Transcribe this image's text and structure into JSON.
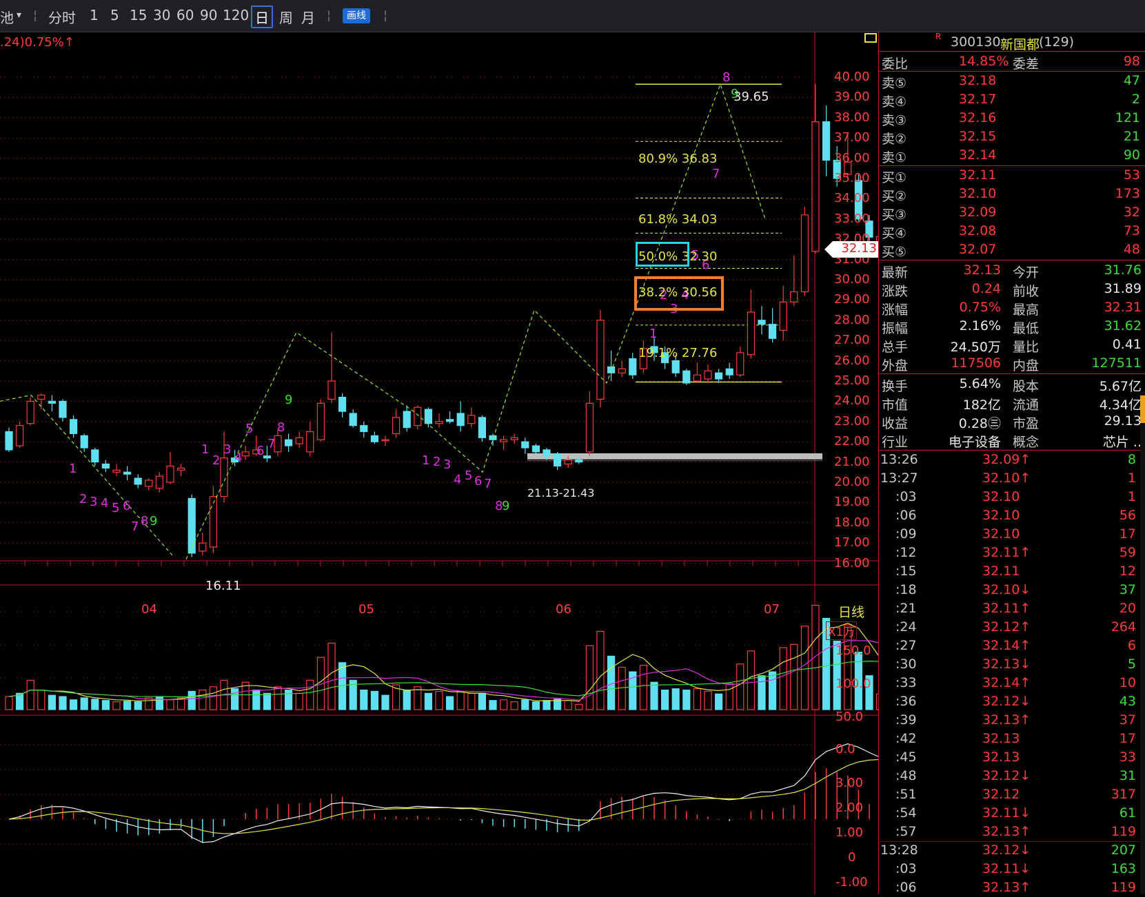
{
  "toolbar": {
    "stock_short": "池",
    "dropdown": "▾",
    "periods": [
      "分时",
      "1",
      "5",
      "15",
      "30",
      "60",
      "90",
      "120",
      "日",
      "周",
      "月"
    ],
    "active_period": "日",
    "draw_button": "画线"
  },
  "chart_header": {
    "change_text": ".24)0.75%↑"
  },
  "price_axis": [
    "40.00",
    "39.00",
    "38.00",
    "37.00",
    "36.00",
    "35.00",
    "34.00",
    "33.00",
    "32.00",
    "31.00",
    "30.00",
    "29.00",
    "28.00",
    "27.00",
    "26.00",
    "25.00",
    "24.00",
    "23.00",
    "22.00",
    "21.00",
    "20.00",
    "19.00",
    "18.00",
    "17.00",
    "16.00"
  ],
  "current_price_tag": "32.13",
  "annotations": {
    "high_label": "39.65",
    "low_label": "16.11",
    "gap_label": "21.13-21.43",
    "fib": [
      {
        "label": "80.9% 36.83",
        "price": 36.83
      },
      {
        "label": "61.8% 34.03",
        "price": 34.03
      },
      {
        "label": "50.0% 32.30",
        "price": 32.3
      },
      {
        "label": "38.2% 30.56",
        "price": 30.56
      },
      {
        "label": "19.1% 27.76",
        "price": 27.76
      }
    ],
    "fib_high": 39.65,
    "fib_low": 24.95,
    "fib_box_colors": {
      "50": "#29d3e3",
      "38": "#f08030"
    }
  },
  "month_labels": [
    "04",
    "05",
    "06",
    "07"
  ],
  "period_tag": "日线",
  "volume_panel": {
    "unit": "X1万",
    "axis": [
      "150.0",
      "100.0",
      "50.0",
      "0.0"
    ]
  },
  "macd_panel": {
    "axis": [
      "3.00",
      "2.00",
      "1.00",
      "0",
      "-1.00"
    ]
  },
  "quote": {
    "flag": "R",
    "code": "300130",
    "name": "新国都",
    "count": "(129)",
    "weibi_label": "委比",
    "weibi": "14.85%",
    "weicha_label": "委差",
    "weicha": "98",
    "sell": [
      {
        "label": "卖⑤",
        "price": "32.18",
        "vol": "47"
      },
      {
        "label": "卖④",
        "price": "32.17",
        "vol": "2"
      },
      {
        "label": "卖③",
        "price": "32.16",
        "vol": "121"
      },
      {
        "label": "卖②",
        "price": "32.15",
        "vol": "21"
      },
      {
        "label": "卖①",
        "price": "32.14",
        "vol": "90"
      }
    ],
    "buy": [
      {
        "label": "买①",
        "price": "32.11",
        "vol": "53"
      },
      {
        "label": "买②",
        "price": "32.10",
        "vol": "173"
      },
      {
        "label": "买③",
        "price": "32.09",
        "vol": "32"
      },
      {
        "label": "买④",
        "price": "32.08",
        "vol": "73"
      },
      {
        "label": "买⑤",
        "price": "32.07",
        "vol": "48"
      }
    ],
    "stats": [
      {
        "l1": "最新",
        "v1": "32.13",
        "c1": "red",
        "l2": "今开",
        "v2": "31.76",
        "c2": "green"
      },
      {
        "l1": "涨跌",
        "v1": "0.24",
        "c1": "red",
        "l2": "前收",
        "v2": "31.89",
        "c2": "white"
      },
      {
        "l1": "涨幅",
        "v1": "0.75%",
        "c1": "red",
        "l2": "最高",
        "v2": "32.31",
        "c2": "red"
      },
      {
        "l1": "振幅",
        "v1": "2.16%",
        "c1": "white",
        "l2": "最低",
        "v2": "31.62",
        "c2": "green"
      },
      {
        "l1": "总手",
        "v1": "24.50万",
        "c1": "white",
        "l2": "量比",
        "v2": "0.41",
        "c2": "white"
      },
      {
        "l1": "外盘",
        "v1": "117506",
        "c1": "red",
        "l2": "内盘",
        "v2": "127511",
        "c2": "green"
      }
    ],
    "stats2": [
      {
        "l1": "换手",
        "v1": "5.64%",
        "l2": "股本",
        "v2": "5.67亿"
      },
      {
        "l1": "市值",
        "v1": "182亿",
        "l2": "流通",
        "v2": "4.34亿"
      },
      {
        "l1": "收益",
        "v1": "0.28㊂",
        "l2": "市盈",
        "v2": "29.13"
      },
      {
        "l1": "行业",
        "v1": "电子设备",
        "l2": "概念",
        "v2": "芯片 .."
      }
    ]
  },
  "ticks": [
    {
      "t": "13:26",
      "p": "32.09↑",
      "pc": "red",
      "v": "8",
      "vc": "green"
    },
    {
      "t": "13:27",
      "p": "32.10↑",
      "pc": "red",
      "v": "1",
      "vc": "red"
    },
    {
      "t": ":03",
      "p": "32.10",
      "pc": "red",
      "v": "1",
      "vc": "red"
    },
    {
      "t": ":06",
      "p": "32.10",
      "pc": "red",
      "v": "56",
      "vc": "red"
    },
    {
      "t": ":09",
      "p": "32.10",
      "pc": "red",
      "v": "17",
      "vc": "red"
    },
    {
      "t": ":12",
      "p": "32.11↑",
      "pc": "red",
      "v": "59",
      "vc": "red"
    },
    {
      "t": ":15",
      "p": "32.11",
      "pc": "red",
      "v": "12",
      "vc": "red"
    },
    {
      "t": ":18",
      "p": "32.10↓",
      "pc": "red",
      "v": "37",
      "vc": "green"
    },
    {
      "t": ":21",
      "p": "32.11↑",
      "pc": "red",
      "v": "20",
      "vc": "red"
    },
    {
      "t": ":24",
      "p": "32.12↑",
      "pc": "red",
      "v": "264",
      "vc": "red"
    },
    {
      "t": ":27",
      "p": "32.14↑",
      "pc": "red",
      "v": "6",
      "vc": "red"
    },
    {
      "t": ":30",
      "p": "32.13↓",
      "pc": "red",
      "v": "5",
      "vc": "green"
    },
    {
      "t": ":33",
      "p": "32.14↑",
      "pc": "red",
      "v": "10",
      "vc": "red"
    },
    {
      "t": ":36",
      "p": "32.12↓",
      "pc": "red",
      "v": "43",
      "vc": "green"
    },
    {
      "t": ":39",
      "p": "32.13↑",
      "pc": "red",
      "v": "37",
      "vc": "red"
    },
    {
      "t": ":42",
      "p": "32.13",
      "pc": "red",
      "v": "17",
      "vc": "red"
    },
    {
      "t": ":45",
      "p": "32.13",
      "pc": "red",
      "v": "33",
      "vc": "red"
    },
    {
      "t": ":48",
      "p": "32.12↓",
      "pc": "red",
      "v": "31",
      "vc": "green"
    },
    {
      "t": ":51",
      "p": "32.12",
      "pc": "red",
      "v": "317",
      "vc": "red"
    },
    {
      "t": ":54",
      "p": "32.11↓",
      "pc": "red",
      "v": "61",
      "vc": "green"
    },
    {
      "t": ":57",
      "p": "32.13↑",
      "pc": "red",
      "v": "119",
      "vc": "red"
    },
    {
      "t": "13:28",
      "p": "32.12↓",
      "pc": "red",
      "v": "207",
      "vc": "green"
    },
    {
      "t": ":03",
      "p": "32.11↓",
      "pc": "red",
      "v": "163",
      "vc": "green"
    },
    {
      "t": ":06",
      "p": "32.13↑",
      "pc": "red",
      "v": "119",
      "vc": "red"
    }
  ],
  "chart_data": {
    "type": "candlestick",
    "candles": [
      [
        22.5,
        21.6,
        22.7,
        21.5
      ],
      [
        21.8,
        22.8,
        23.0,
        21.7
      ],
      [
        22.9,
        24.0,
        24.2,
        22.8
      ],
      [
        24.1,
        24.3,
        24.4,
        23.6
      ],
      [
        24.0,
        23.9,
        24.3,
        23.5
      ],
      [
        24.0,
        23.2,
        24.1,
        23.0
      ],
      [
        23.1,
        22.4,
        23.3,
        22.2
      ],
      [
        22.3,
        21.7,
        22.4,
        21.5
      ],
      [
        21.6,
        21.0,
        21.7,
        20.8
      ],
      [
        20.9,
        20.7,
        21.1,
        20.5
      ],
      [
        20.5,
        20.6,
        20.9,
        20.3
      ],
      [
        20.5,
        20.4,
        20.8,
        20.1
      ],
      [
        20.2,
        19.9,
        20.4,
        19.7
      ],
      [
        19.8,
        20.1,
        20.2,
        19.6
      ],
      [
        19.7,
        20.3,
        20.5,
        19.5
      ],
      [
        20.0,
        20.8,
        21.5,
        19.9
      ],
      [
        20.6,
        20.7,
        20.9,
        20.3
      ],
      [
        19.2,
        16.5,
        19.4,
        16.3
      ],
      [
        16.6,
        17.0,
        17.5,
        16.4
      ],
      [
        16.8,
        19.3,
        19.8,
        16.5
      ],
      [
        19.3,
        21.2,
        22.5,
        19.0
      ],
      [
        21.2,
        21.0,
        21.6,
        20.8
      ],
      [
        21.3,
        21.5,
        21.8,
        21.1
      ],
      [
        21.4,
        21.6,
        22.3,
        21.3
      ],
      [
        21.3,
        21.2,
        21.8,
        21.0
      ],
      [
        21.5,
        22.3,
        22.6,
        21.3
      ],
      [
        22.1,
        21.8,
        22.4,
        21.5
      ],
      [
        21.9,
        22.2,
        22.5,
        21.7
      ],
      [
        21.5,
        22.5,
        23.0,
        21.3
      ],
      [
        22.1,
        23.9,
        24.1,
        22.0
      ],
      [
        24.1,
        25.0,
        27.4,
        23.9
      ],
      [
        24.2,
        23.5,
        24.4,
        23.2
      ],
      [
        23.4,
        22.8,
        23.6,
        22.7
      ],
      [
        22.8,
        22.5,
        23.0,
        22.2
      ],
      [
        22.3,
        22.0,
        22.5,
        21.9
      ],
      [
        22.1,
        22.1,
        22.3,
        21.8
      ],
      [
        22.4,
        23.2,
        23.6,
        22.2
      ],
      [
        23.5,
        22.7,
        23.8,
        22.5
      ],
      [
        22.8,
        23.7,
        23.8,
        22.6
      ],
      [
        23.6,
        22.9,
        23.7,
        22.7
      ],
      [
        22.9,
        23.0,
        23.4,
        22.7
      ],
      [
        23.1,
        23.0,
        23.5,
        22.9
      ],
      [
        23.4,
        22.8,
        24.0,
        22.5
      ],
      [
        22.9,
        23.3,
        23.7,
        22.7
      ],
      [
        23.2,
        22.2,
        23.3,
        22.0
      ],
      [
        22.3,
        22.1,
        22.4,
        21.8
      ],
      [
        22.0,
        22.1,
        22.3,
        21.6
      ],
      [
        22.1,
        22.2,
        22.4,
        21.9
      ],
      [
        22.0,
        21.7,
        22.2,
        21.4
      ],
      [
        21.8,
        21.5,
        21.9,
        21.3
      ],
      [
        21.6,
        21.3,
        21.7,
        21.1
      ],
      [
        21.4,
        20.8,
        21.5,
        20.6
      ],
      [
        20.9,
        21.1,
        21.3,
        20.7
      ],
      [
        21.1,
        21.0,
        21.3,
        20.9
      ],
      [
        21.5,
        23.9,
        24.5,
        21.3
      ],
      [
        24.1,
        28.0,
        28.5,
        23.7
      ],
      [
        25.7,
        25.4,
        26.5,
        25.0
      ],
      [
        25.4,
        25.6,
        26.0,
        25.2
      ],
      [
        26.1,
        25.3,
        26.4,
        25.1
      ],
      [
        25.6,
        26.6,
        27.0,
        25.4
      ],
      [
        26.7,
        26.4,
        27.2,
        26.0
      ],
      [
        26.4,
        25.9,
        26.7,
        25.6
      ],
      [
        26.0,
        25.4,
        26.3,
        25.2
      ],
      [
        25.5,
        24.9,
        25.6,
        24.8
      ],
      [
        25.0,
        25.3,
        25.9,
        24.9
      ],
      [
        25.1,
        25.5,
        25.8,
        24.9
      ],
      [
        25.4,
        25.1,
        25.6,
        24.9
      ],
      [
        25.6,
        25.3,
        25.9,
        25.1
      ],
      [
        25.3,
        26.4,
        26.7,
        25.2
      ],
      [
        26.3,
        28.4,
        29.5,
        26.1
      ],
      [
        28.0,
        27.8,
        28.7,
        27.3
      ],
      [
        27.8,
        27.1,
        28.6,
        26.9
      ],
      [
        27.5,
        28.9,
        29.7,
        27.0
      ],
      [
        28.9,
        29.4,
        31.2,
        28.7
      ],
      [
        29.4,
        33.2,
        33.6,
        29.2
      ],
      [
        31.4,
        37.8,
        39.65,
        31.3
      ],
      [
        37.8,
        35.9,
        38.6,
        35.1
      ],
      [
        35.9,
        35.0,
        36.6,
        34.6
      ],
      [
        35.2,
        35.8,
        37.2,
        34.9
      ],
      [
        34.9,
        33.0,
        35.2,
        32.9
      ],
      [
        32.9,
        32.1,
        33.2,
        31.9
      ],
      [
        31.76,
        32.13,
        32.31,
        31.62
      ]
    ],
    "volume": [
      [
        20,
        "u"
      ],
      [
        25,
        "d"
      ],
      [
        45,
        "u"
      ],
      [
        30,
        "u"
      ],
      [
        22,
        "d"
      ],
      [
        20,
        "d"
      ],
      [
        15,
        "d"
      ],
      [
        18,
        "d"
      ],
      [
        16,
        "d"
      ],
      [
        14,
        "d"
      ],
      [
        12,
        "u"
      ],
      [
        13,
        "d"
      ],
      [
        12,
        "d"
      ],
      [
        18,
        "u"
      ],
      [
        20,
        "d"
      ],
      [
        15,
        "u"
      ],
      [
        18,
        "u"
      ],
      [
        28,
        "d"
      ],
      [
        30,
        "u"
      ],
      [
        35,
        "u"
      ],
      [
        45,
        "u"
      ],
      [
        32,
        "d"
      ],
      [
        42,
        "u"
      ],
      [
        30,
        "d"
      ],
      [
        25,
        "d"
      ],
      [
        35,
        "u"
      ],
      [
        30,
        "d"
      ],
      [
        25,
        "u"
      ],
      [
        45,
        "u"
      ],
      [
        80,
        "u"
      ],
      [
        102,
        "u"
      ],
      [
        72,
        "d"
      ],
      [
        45,
        "d"
      ],
      [
        30,
        "d"
      ],
      [
        28,
        "d"
      ],
      [
        22,
        "d"
      ],
      [
        38,
        "u"
      ],
      [
        30,
        "d"
      ],
      [
        35,
        "u"
      ],
      [
        25,
        "d"
      ],
      [
        28,
        "u"
      ],
      [
        20,
        "d"
      ],
      [
        28,
        "u"
      ],
      [
        25,
        "u"
      ],
      [
        25,
        "d"
      ],
      [
        14,
        "d"
      ],
      [
        15,
        "u"
      ],
      [
        12,
        "u"
      ],
      [
        15,
        "d"
      ],
      [
        12,
        "d"
      ],
      [
        14,
        "d"
      ],
      [
        16,
        "d"
      ],
      [
        14,
        "u"
      ],
      [
        8,
        "u"
      ],
      [
        98,
        "u"
      ],
      [
        120,
        "u"
      ],
      [
        82,
        "d"
      ],
      [
        65,
        "u"
      ],
      [
        58,
        "d"
      ],
      [
        68,
        "u"
      ],
      [
        42,
        "d"
      ],
      [
        30,
        "d"
      ],
      [
        32,
        "d"
      ],
      [
        30,
        "d"
      ],
      [
        32,
        "u"
      ],
      [
        28,
        "u"
      ],
      [
        24,
        "d"
      ],
      [
        40,
        "u"
      ],
      [
        70,
        "u"
      ],
      [
        90,
        "u"
      ],
      [
        52,
        "d"
      ],
      [
        58,
        "d"
      ],
      [
        95,
        "u"
      ],
      [
        100,
        "u"
      ],
      [
        128,
        "u"
      ],
      [
        160,
        "u"
      ],
      [
        140,
        "d"
      ],
      [
        105,
        "d"
      ],
      [
        130,
        "u"
      ],
      [
        88,
        "d"
      ],
      [
        52,
        "d"
      ],
      [
        24,
        "u"
      ]
    ],
    "macd_axis_range": [
      -1.0,
      3.0
    ],
    "volume_axis_range": [
      0,
      160
    ],
    "price_axis_range": [
      16.0,
      40.0
    ]
  }
}
